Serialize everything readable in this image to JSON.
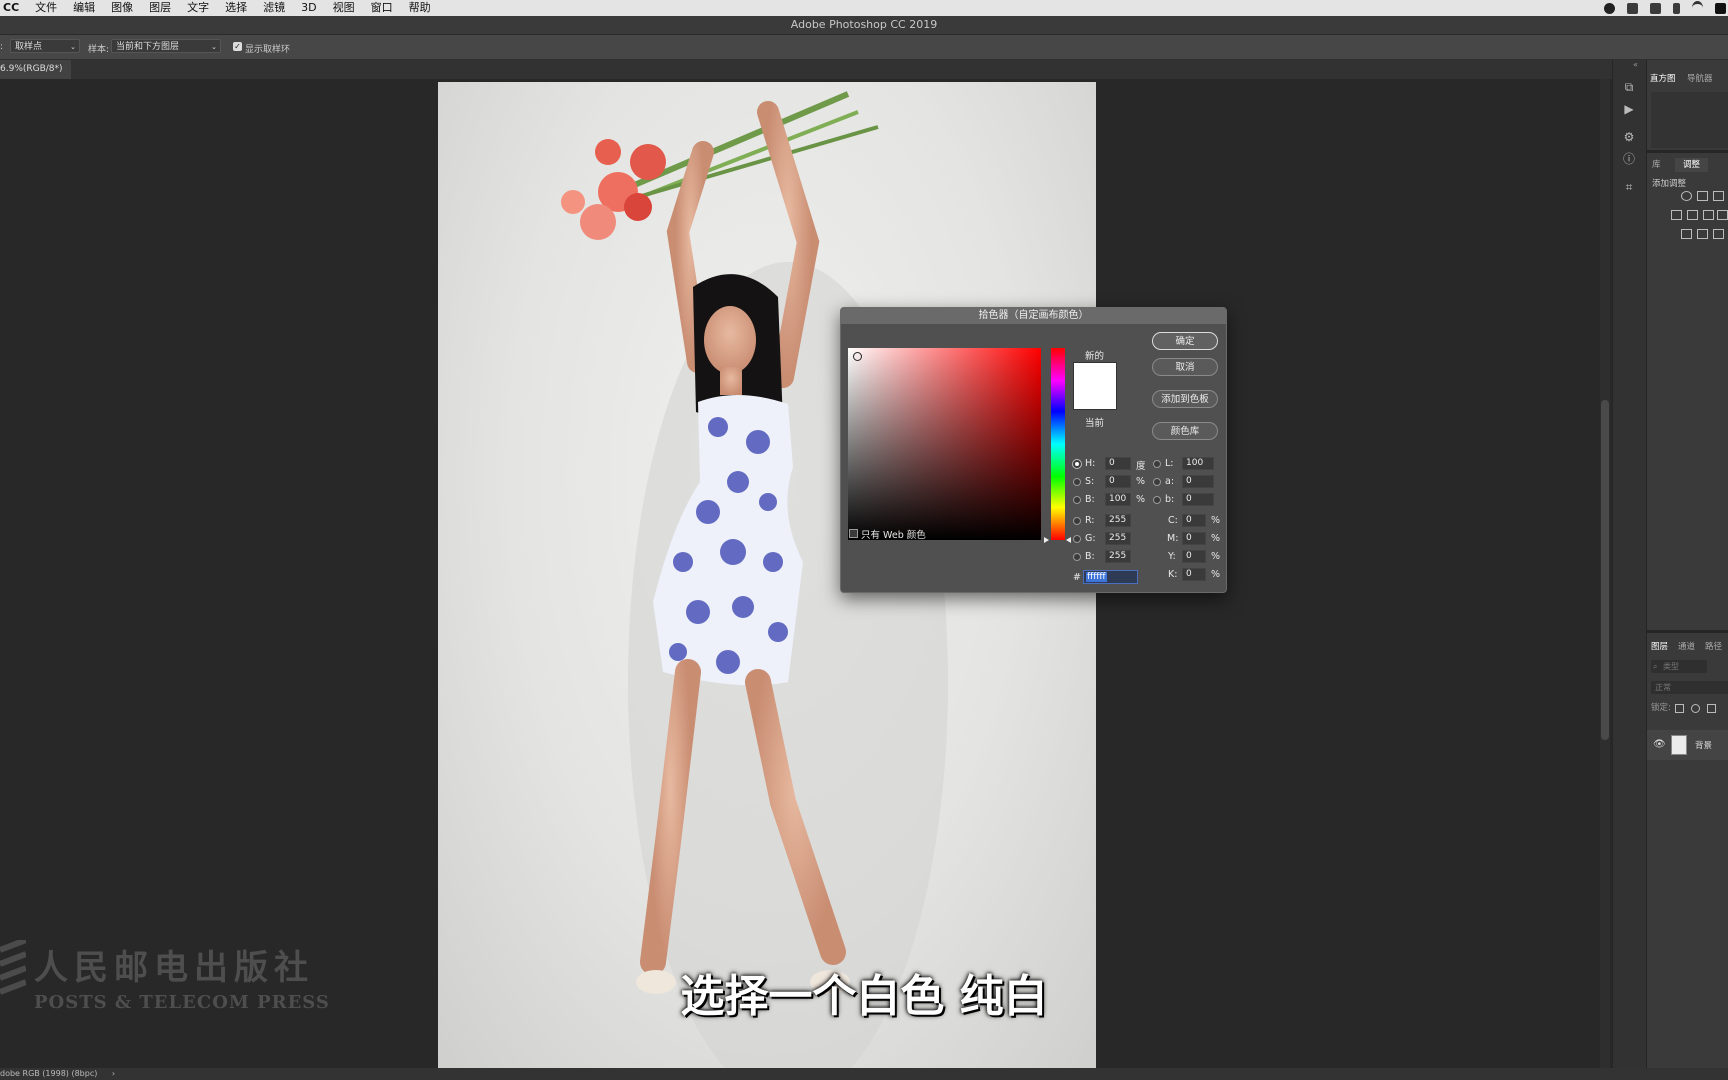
{
  "menubar": {
    "app": "CC",
    "items": [
      "文件",
      "编辑",
      "图像",
      "图层",
      "文字",
      "选择",
      "滤镜",
      "3D",
      "视图",
      "窗口",
      "帮助"
    ]
  },
  "window_title": "Adobe Photoshop CC 2019",
  "options": {
    "sample_size_value": "取样点",
    "sample_label": "样本:",
    "sample_value": "当前和下方图层",
    "show_ring_label": "显示取样环",
    "show_ring_checked": true
  },
  "doc_tab": "6.9%(RGB/8*)",
  "panels": {
    "top_tabs": [
      "直方图",
      "导航器"
    ],
    "mid_tabs": [
      "库",
      "调整"
    ],
    "adjust_title": "添加调整",
    "layer_tabs": [
      "图层",
      "通道",
      "路径"
    ],
    "layer_search": "类型",
    "blend_mode": "正常",
    "lock_label": "锁定:",
    "layer_name": "背景"
  },
  "status": {
    "profile": "dobe RGB (1998) (8bpc)",
    "arrow": "›"
  },
  "dialog": {
    "title": "拾色器（自定画布颜色）",
    "new_label": "新的",
    "current_label": "当前",
    "buttons": {
      "ok": "确定",
      "cancel": "取消",
      "add_swatch": "添加到色板",
      "color_library": "颜色库"
    },
    "web_only_label": "只有 Web 颜色",
    "hsb": {
      "h_label": "H:",
      "h": "0",
      "h_unit": "度",
      "s_label": "S:",
      "s": "0",
      "s_unit": "%",
      "b_label": "B:",
      "b": "100",
      "b_unit": "%"
    },
    "rgb": {
      "r_label": "R:",
      "r": "255",
      "g_label": "G:",
      "g": "255",
      "b_label": "B:",
      "b": "255"
    },
    "lab": {
      "l_label": "L:",
      "l": "100",
      "a_label": "a:",
      "a": "0",
      "b_label": "b:",
      "b": "0"
    },
    "cmyk": {
      "c_label": "C:",
      "c": "0",
      "m_label": "M:",
      "m": "0",
      "y_label": "Y:",
      "y": "0",
      "k_label": "K:",
      "k": "0",
      "unit": "%"
    },
    "hex_label": "#",
    "hex": "ffffff",
    "selected_color": "#ffffff"
  },
  "watermark": {
    "cn": "人民邮电出版社",
    "en": "POSTS & TELECOM PRESS"
  },
  "subtitle": "选择一个白色 纯白"
}
